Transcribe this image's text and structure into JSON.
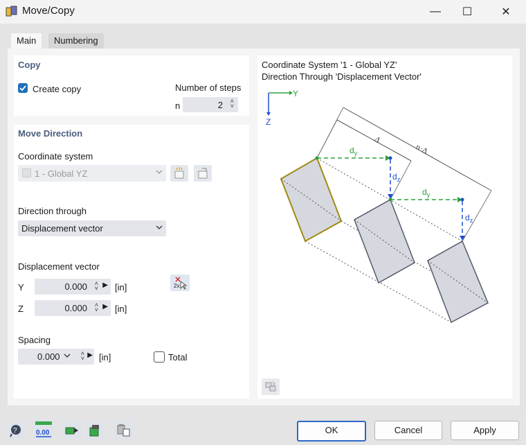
{
  "window": {
    "title": "Move/Copy",
    "minimize": "—",
    "maximize": "☐",
    "close": "✕"
  },
  "tabs": [
    {
      "label": "Main",
      "active": true
    },
    {
      "label": "Numbering",
      "active": false
    }
  ],
  "copy": {
    "title": "Copy",
    "create_copy_label": "Create copy",
    "create_copy_checked": true,
    "steps_label": "Number of steps",
    "n_label": "n",
    "n_value": "2"
  },
  "move": {
    "title": "Move Direction",
    "coord_label": "Coordinate system",
    "coord_value": "1 - Global YZ",
    "dir_label": "Direction through",
    "dir_value": "Displacement vector",
    "disp_label": "Displacement vector",
    "y_label": "Y",
    "y_value": "0.000",
    "y_unit": "[in]",
    "z_label": "Z",
    "z_value": "0.000",
    "z_unit": "[in]",
    "spacing_label": "Spacing",
    "spacing_value": "0.000",
    "spacing_unit": "[in]",
    "total_label": "Total",
    "total_checked": false
  },
  "preview": {
    "line1": "Coordinate System '1 - Global YZ'",
    "line2": "Direction Through 'Displacement Vector'",
    "axis_y": "Y",
    "axis_z": "Z",
    "dy": "d",
    "dy_sub": "y",
    "dz": "d",
    "dz_sub": "z",
    "delta": "Δ",
    "ndelta": "n·Δ"
  },
  "footer": {
    "ok": "OK",
    "cancel": "Cancel",
    "apply": "Apply",
    "units_icon_text": "0.00"
  },
  "colors": {
    "accent": "#1d6fb8",
    "green": "#2aa23a",
    "blue": "#1f4fd0",
    "section": "#4a5d7e",
    "shape_fill": "#d6d8df",
    "highlight": "#a08a14"
  },
  "icons": [
    "app-icon",
    "help-icon",
    "units-icon",
    "select-icon",
    "export-icon",
    "library-icon",
    "reset-view-icon",
    "pick-vector-icon",
    "new-coordinate-system-icon",
    "edit-coordinate-system-icon"
  ]
}
